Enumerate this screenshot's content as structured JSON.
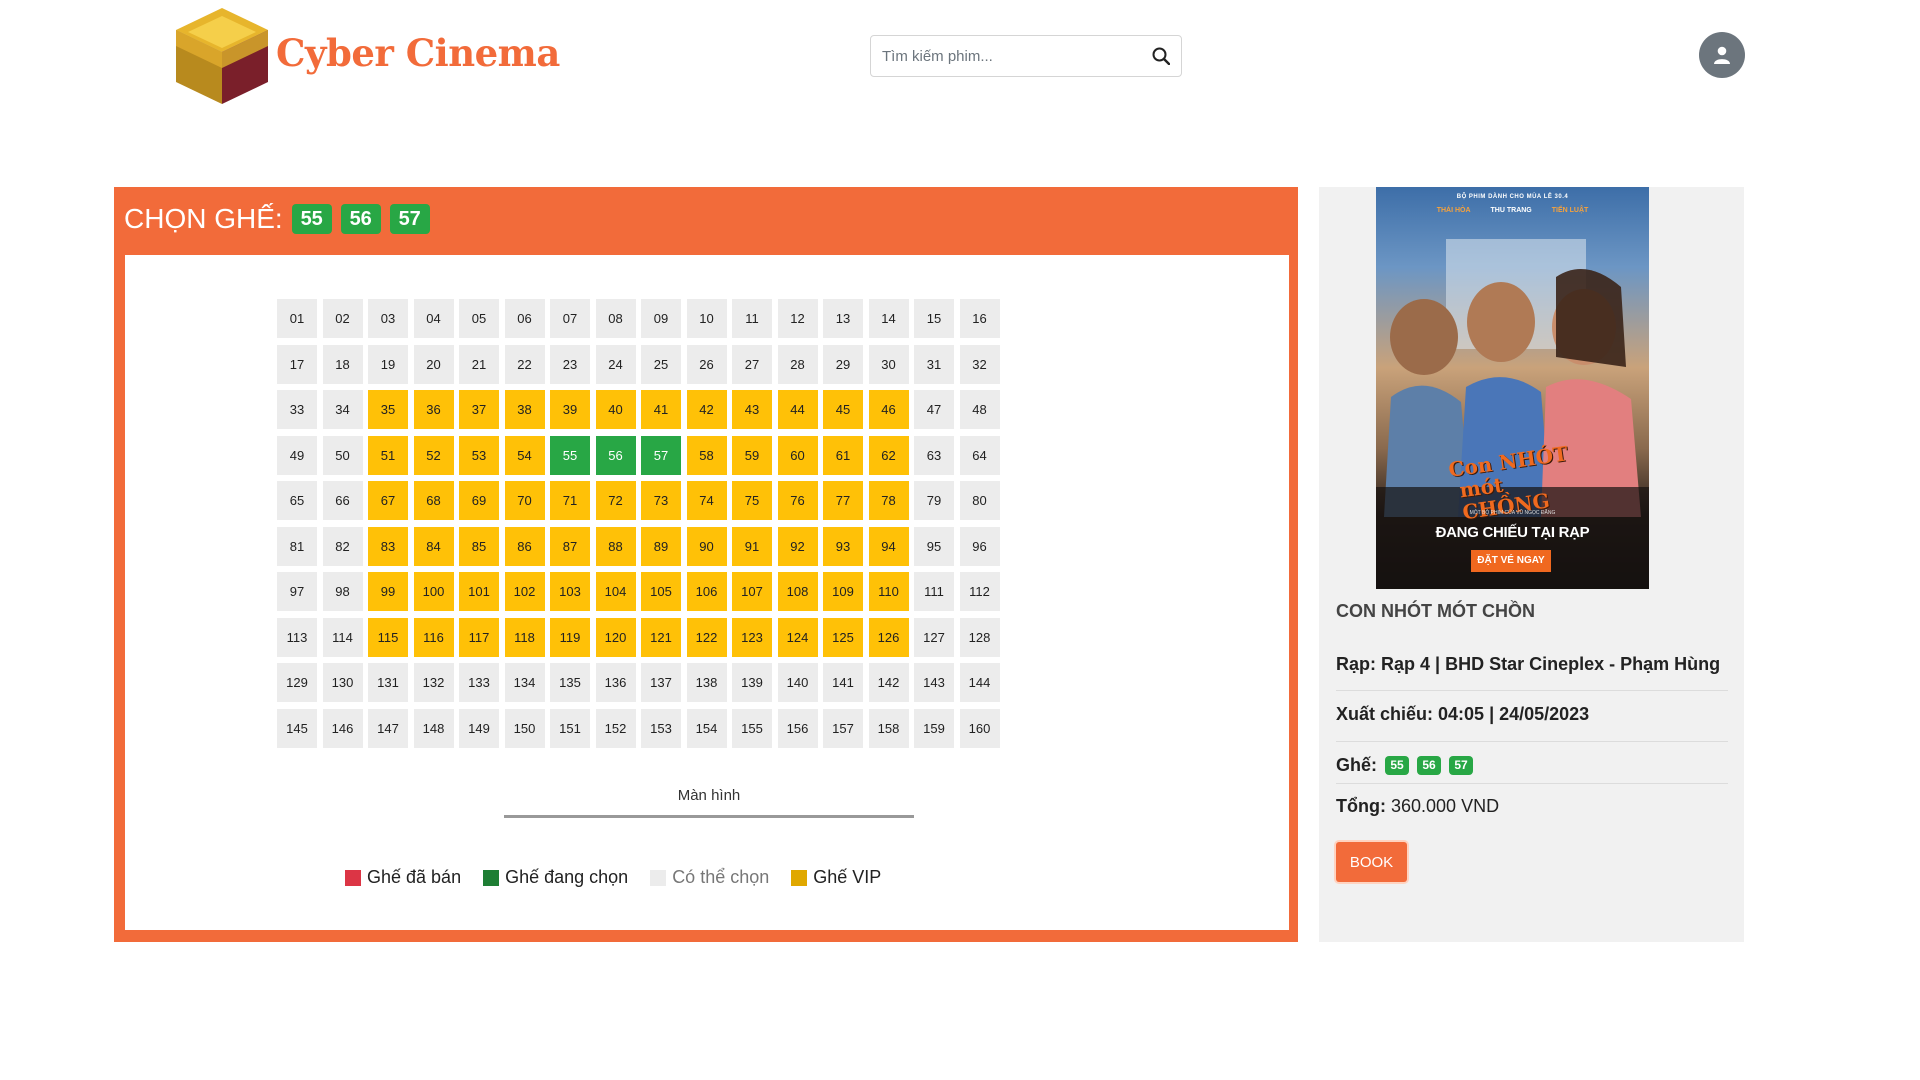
{
  "header": {
    "brand": "Cyber Cinema",
    "search_placeholder": "Tìm kiếm phim...",
    "search_icon": "search-icon",
    "avatar_icon": "user-icon"
  },
  "booking": {
    "title_label": "CHỌN GHẾ:",
    "selected_seats": [
      "55",
      "56",
      "57"
    ],
    "screen_label": "Màn hình",
    "vip_seats": [
      "35",
      "36",
      "37",
      "38",
      "39",
      "40",
      "41",
      "42",
      "43",
      "44",
      "45",
      "46",
      "51",
      "52",
      "53",
      "54",
      "58",
      "59",
      "60",
      "61",
      "62",
      "67",
      "68",
      "69",
      "70",
      "71",
      "72",
      "73",
      "74",
      "75",
      "76",
      "77",
      "78",
      "83",
      "84",
      "85",
      "86",
      "87",
      "88",
      "89",
      "90",
      "91",
      "92",
      "93",
      "94",
      "99",
      "100",
      "101",
      "102",
      "103",
      "104",
      "105",
      "106",
      "107",
      "108",
      "109",
      "110",
      "115",
      "116",
      "117",
      "118",
      "119",
      "120",
      "121",
      "122",
      "123",
      "124",
      "125",
      "126"
    ],
    "sold_seats": [],
    "seat_count": 160,
    "legend": [
      {
        "label": "Ghế đã bán",
        "color": "#dc3545"
      },
      {
        "label": "Ghế đang chọn",
        "color": "#28a745"
      },
      {
        "label": "Có thể chọn",
        "color": "#ececec"
      },
      {
        "label": "Ghế VIP",
        "color": "#e0a800"
      }
    ]
  },
  "info": {
    "poster_credits": "BỘ PHIM DÀNH CHO MÙA LỄ 30.4",
    "poster_actors": [
      "THÁI HÒA",
      "THU TRANG",
      "TIẾN LUẬT"
    ],
    "poster_director": "MỘT BỘ PHIM CỦA VŨ NGỌC ĐÃNG",
    "poster_title_line1": "Con NHÓT",
    "poster_title_line2": "mót CHỒNG",
    "poster_now_showing": "ĐANG CHIẾU TẠI RẠP",
    "poster_cta": "ĐẶT VÉ NGAY",
    "movie_title": "CON NHÓT MÓT CHỒN",
    "theater_label": "Rạp:",
    "theater_value": "Rạp 4 | BHD Star Cineplex - Phạm Hùng",
    "showtime_label": "Xuất chiếu:",
    "showtime_value": "04:05 | 24/05/2023",
    "seats_label": "Ghế:",
    "total_label": "Tổng:",
    "total_value": "360.000 VND",
    "book_label": "BOOK"
  },
  "colors": {
    "brand_orange": "#f26b3a",
    "selected_green": "#28a745",
    "vip_yellow": "#ffc107",
    "available_gray": "#ececec",
    "sold_red": "#dc3545"
  }
}
